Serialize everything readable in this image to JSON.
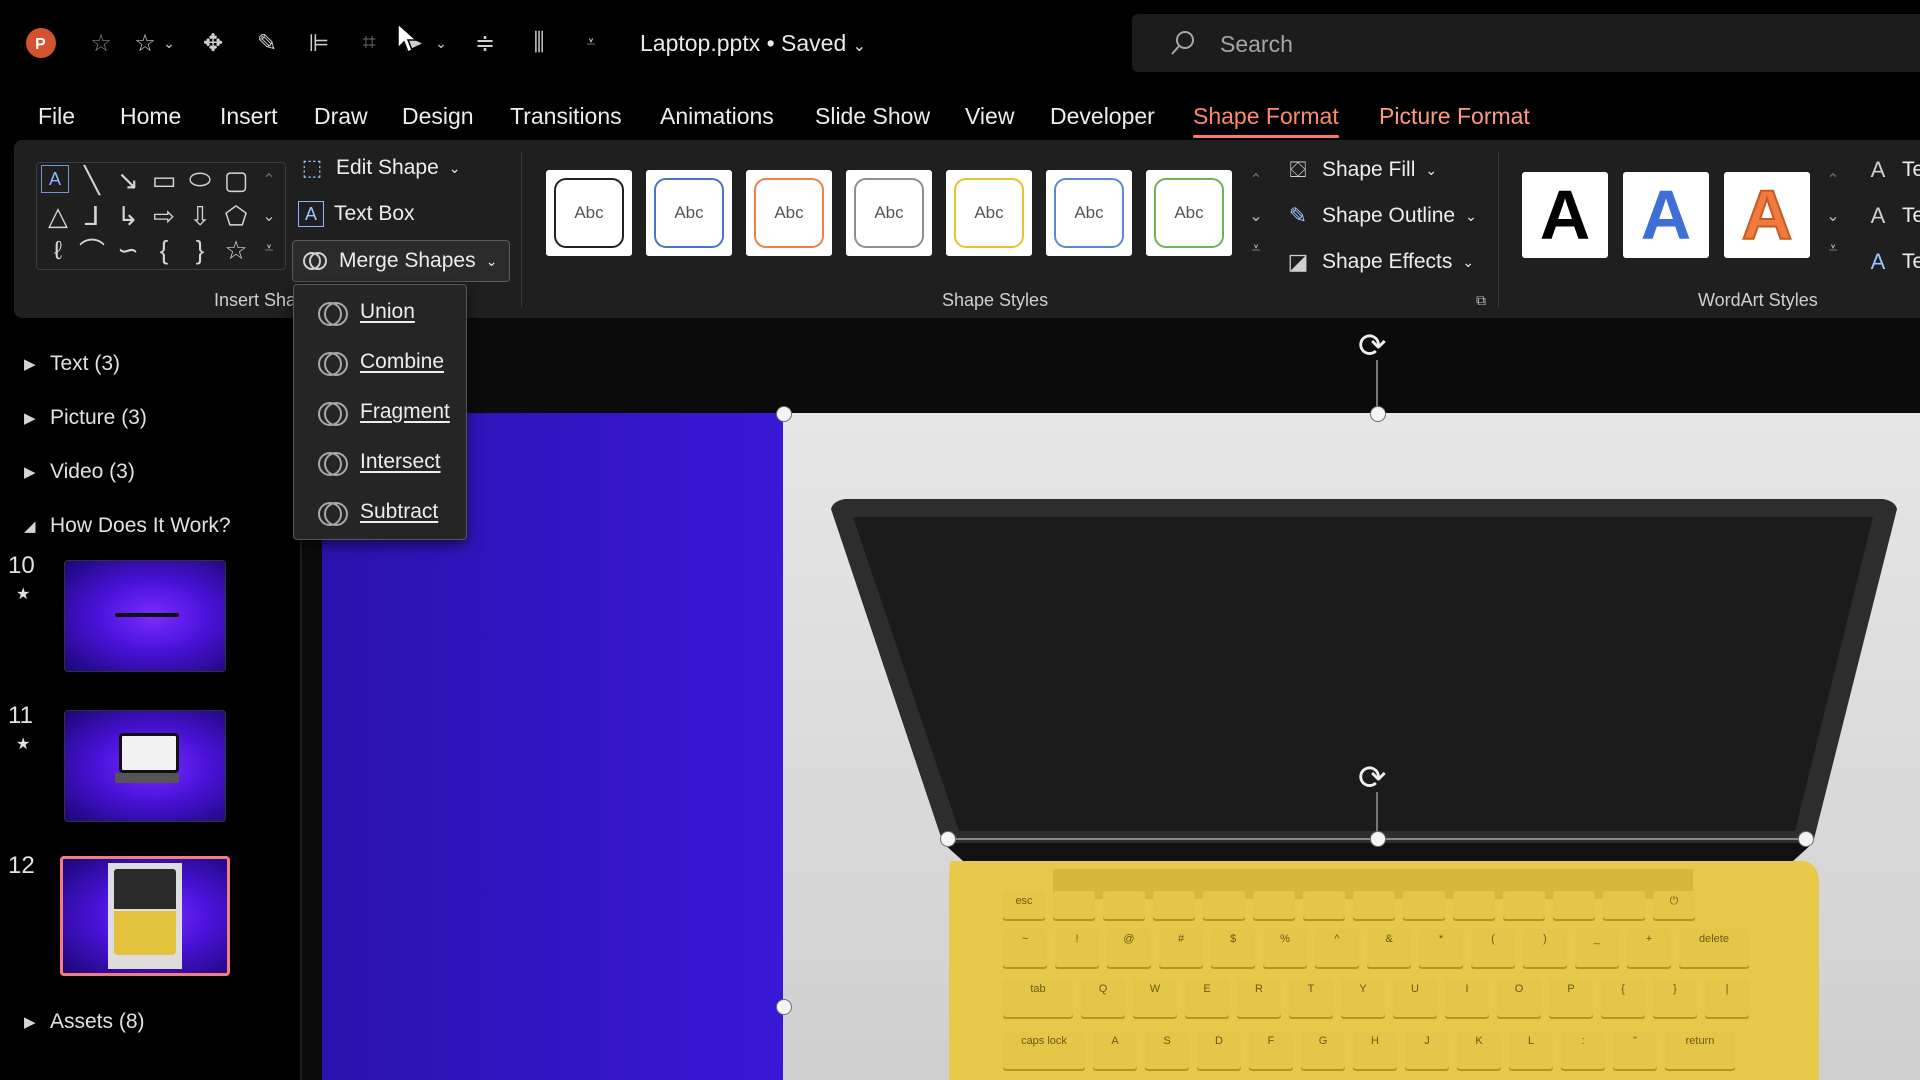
{
  "window": {
    "doc_title": "Laptop.pptx • Saved",
    "search_placeholder": "Search"
  },
  "menu": [
    "File",
    "Home",
    "Insert",
    "Draw",
    "Design",
    "Transitions",
    "Animations",
    "Slide Show",
    "View",
    "Developer",
    "Shape Format",
    "Picture Format"
  ],
  "active_tab": "Shape Format",
  "ribbon": {
    "edit_shape": "Edit Shape",
    "text_box": "Text Box",
    "merge_shapes": "Merge Shapes",
    "insert_shapes_label": "Insert Sha",
    "shape_style_tiles": [
      "Abc",
      "Abc",
      "Abc",
      "Abc",
      "Abc",
      "Abc",
      "Abc"
    ],
    "shape_style_colors": [
      "#222222",
      "#4a74c9",
      "#e8834d",
      "#8f8f8f",
      "#e8c22e",
      "#5b89d8",
      "#6fb356"
    ],
    "shape_styles_label": "Shape Styles",
    "shape_fill": "Shape Fill",
    "shape_outline": "Shape Outline",
    "shape_effects": "Shape Effects",
    "wordart_letter": "A",
    "wordart_colors": [
      "#000000",
      "#3f6fd6",
      "#f07a3f"
    ],
    "wordart_label": "WordArt Styles",
    "text_cmds": [
      "Te",
      "Te",
      "Te"
    ]
  },
  "merge_menu": [
    "Union",
    "Combine",
    "Fragment",
    "Intersect",
    "Subtract"
  ],
  "merge_menu_underline": [
    "U",
    "C",
    "F",
    "I",
    "S"
  ],
  "pane": {
    "sections": [
      "Text (3)",
      "Picture (3)",
      "Video (3)",
      "How Does It Work?",
      "Assets (8)"
    ],
    "slides": [
      {
        "num": "10"
      },
      {
        "num": "11"
      },
      {
        "num": "12"
      }
    ]
  },
  "keyboard": {
    "row1": [
      "esc",
      "",
      "",
      "",
      "",
      "",
      "",
      "",
      "",
      "",
      "",
      "",
      "",
      "⏻"
    ],
    "row2": [
      "~",
      "!",
      "@",
      "#",
      "$",
      "%",
      "^",
      "&",
      "*",
      "(",
      ")",
      "_",
      "+",
      "delete"
    ],
    "row3": [
      "tab",
      "Q",
      "W",
      "E",
      "R",
      "T",
      "Y",
      "U",
      "I",
      "O",
      "P",
      "{",
      "}",
      "|"
    ],
    "row4": [
      "caps lock",
      "A",
      "S",
      "D",
      "F",
      "G",
      "H",
      "J",
      "K",
      "L",
      ":",
      "\"",
      "return"
    ]
  },
  "colors": {
    "accent": "#ff7a57",
    "slide_purple": "#4a1ee8",
    "selection_border": "#f08080"
  }
}
